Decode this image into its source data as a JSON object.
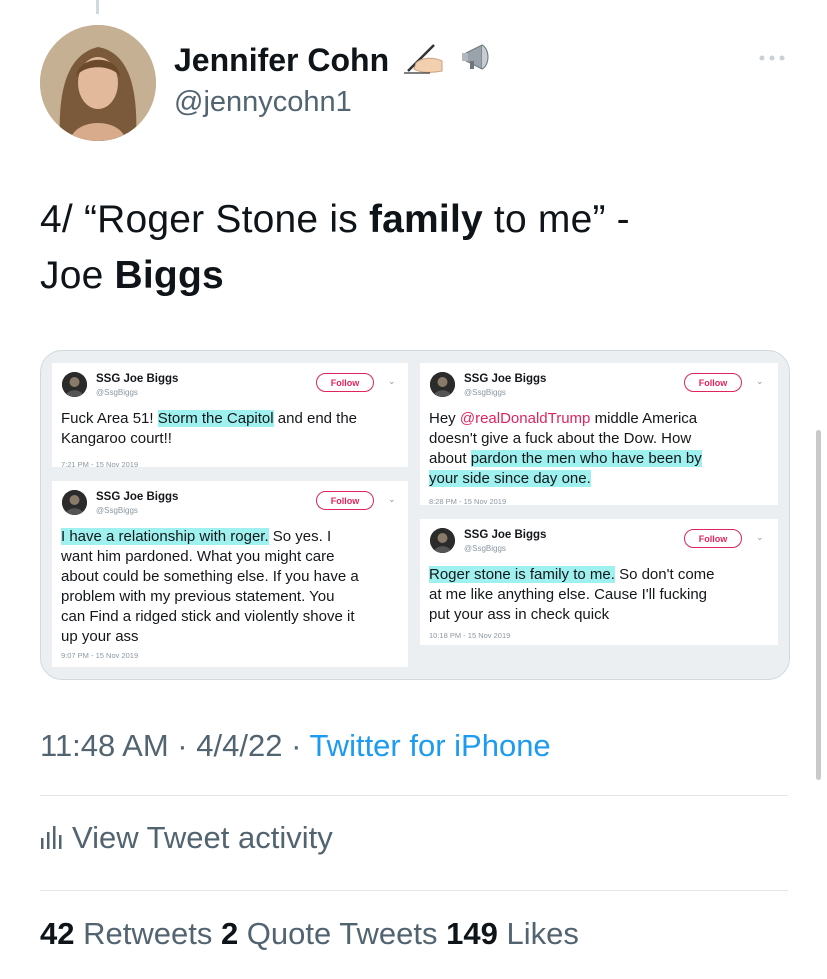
{
  "author": {
    "display_name": "Jennifer Cohn",
    "handle": "@jennycohn1"
  },
  "tweet": {
    "text_parts": [
      {
        "text": "4/ “Roger Stone is ",
        "bold": false
      },
      {
        "text": "family",
        "bold": true
      },
      {
        "text": " to me” -",
        "bold": false
      },
      {
        "text": "Joe ",
        "bold": false
      },
      {
        "text": "Biggs",
        "bold": true
      }
    ]
  },
  "embedded_tweets": [
    {
      "name": "SSG Joe Biggs",
      "handle": "@SsgBiggs",
      "follow_label": "Follow",
      "body": [
        [
          {
            "t": "Fuck Area 51! "
          },
          {
            "t": "Storm the Capitol",
            "hl": true
          },
          {
            "t": " and end the"
          }
        ],
        [
          {
            "t": "Kangaroo court!!"
          }
        ]
      ],
      "time": "7:21 PM - 15 Nov 2019"
    },
    {
      "name": "SSG Joe Biggs",
      "handle": "@SsgBiggs",
      "follow_label": "Follow",
      "body": [
        [
          {
            "t": "I have a relationship with roger.",
            "hl": true
          },
          {
            "t": " So yes. I"
          }
        ],
        [
          {
            "t": "want him pardoned. What you might care"
          }
        ],
        [
          {
            "t": "about could be something else. If you have a"
          }
        ],
        [
          {
            "t": "problem with my previous statement. You"
          }
        ],
        [
          {
            "t": "can Find a ridged stick and violently shove it"
          }
        ],
        [
          {
            "t": "up your ass"
          }
        ]
      ],
      "time": "9:07 PM - 15 Nov 2019"
    },
    {
      "name": "SSG Joe Biggs",
      "handle": "@SsgBiggs",
      "follow_label": "Follow",
      "body": [
        [
          {
            "t": "Hey "
          },
          {
            "t": "@realDonaldTrump",
            "mention": true
          },
          {
            "t": " middle America"
          }
        ],
        [
          {
            "t": "doesn't give a fuck about the Dow. How"
          }
        ],
        [
          {
            "t": "about "
          },
          {
            "t": "pardon the men who have been by",
            "hl": true
          }
        ],
        [
          {
            "t": "your side since day one.",
            "hl": true
          }
        ]
      ],
      "time": "8:28 PM - 15 Nov 2019"
    },
    {
      "name": "SSG Joe Biggs",
      "handle": "@SsgBiggs",
      "follow_label": "Follow",
      "body": [
        [
          {
            "t": "Roger stone is family to me.",
            "hl": true
          },
          {
            "t": " So don't come"
          }
        ],
        [
          {
            "t": "at me  like anything else. Cause I'll fucking"
          }
        ],
        [
          {
            "t": "put your ass in check quick"
          }
        ]
      ],
      "time": "10:18 PM - 15 Nov 2019"
    }
  ],
  "meta": {
    "time": "11:48 AM",
    "sep1": " · ",
    "date": "4/4/22",
    "sep2": " · ",
    "source": "Twitter for iPhone"
  },
  "activity_label": "View Tweet activity",
  "stats": {
    "retweets_count": "42",
    "retweets_label": " Retweets  ",
    "quotes_count": "2",
    "quotes_label": " Quote Tweets  ",
    "likes_count": "149",
    "likes_label": " Likes"
  },
  "icons": {
    "name_emojis": [
      "writing-hand-icon",
      "megaphone-icon"
    ],
    "more": "more-icon",
    "activity": "activity-bars-icon"
  },
  "colors": {
    "link": "#1d9bf0",
    "secondary": "#536471",
    "highlight": "#9ff1ef",
    "follow": "#e0245e"
  }
}
